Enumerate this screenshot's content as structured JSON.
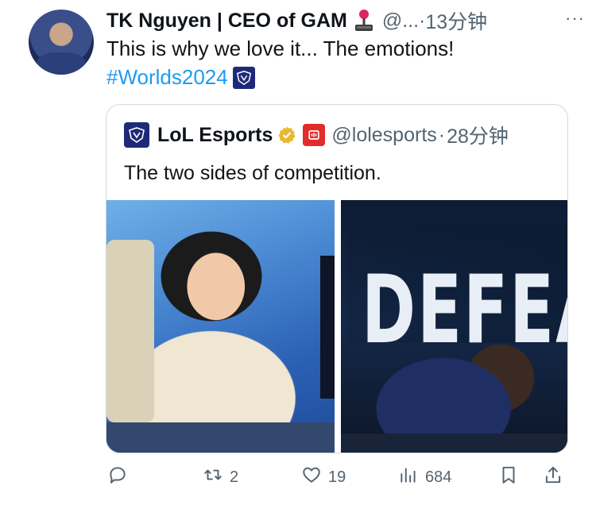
{
  "tweet": {
    "author_name": "TK Nguyen | CEO of GAM",
    "author_handle": "@...",
    "separator": "·",
    "time": "13分钟",
    "more_label": "···",
    "text": "This is why we love it... The emotions!",
    "hashtag": "#Worlds2024"
  },
  "quote": {
    "author_name": "LoL Esports",
    "author_handle": "@lolesports",
    "separator": "·",
    "time": "28分钟",
    "text": "The two sides of competition.",
    "image_text": "DEFEAT"
  },
  "actions": {
    "reply_count": "",
    "retweet_count": "2",
    "like_count": "19",
    "views_count": "684"
  },
  "colors": {
    "accent": "#1d9bf0",
    "text": "#0f1419",
    "muted": "#536471",
    "border": "#cfd9de",
    "verified_gold": "#e8b92f"
  },
  "icons": [
    "joystick-icon",
    "worlds-badge-icon",
    "lolesports-logo-icon",
    "verified-badge-icon",
    "lol-badge-icon",
    "reply-icon",
    "retweet-icon",
    "like-icon",
    "views-icon",
    "bookmark-icon",
    "share-icon"
  ]
}
